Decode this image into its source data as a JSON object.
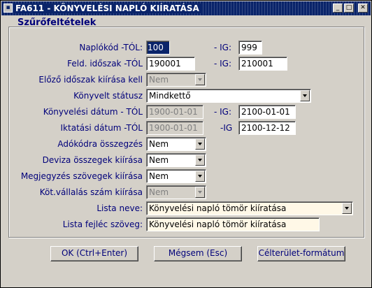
{
  "window": {
    "title": "FA611 - KÖNYVELÉSI NAPLÓ KIÍRATÁSA",
    "app_icon": "form-icon"
  },
  "group_title": "Szűrőfeltételek",
  "fields": {
    "naplokod": {
      "label": "Naplókód -TÓL:",
      "from": "100",
      "to_label": "- IG:",
      "to": "999"
    },
    "feld_idoszak": {
      "label": "Feld. időszak -TÓL",
      "from": "190001",
      "to_label": "- IG:",
      "to": "210001"
    },
    "elozo_idoszak": {
      "label": "Előző időszak kiírása kell",
      "value": "Nem"
    },
    "konyvelt_statusz": {
      "label": "Könyvelt státusz",
      "value": "Mindkettő"
    },
    "konyvelesi_datum": {
      "label": "Könyvelési dátum - TÓL",
      "from": "1900-01-01",
      "to_label": "- IG:",
      "to": "2100-01-01"
    },
    "iktatasi_datum": {
      "label": "Iktatási dátum -TÓL",
      "from": "1900-01-01",
      "to_label": "-IG",
      "to": "2100-12-12"
    },
    "adokodra": {
      "label": "Adókódra összegzés",
      "value": "Nem"
    },
    "deviza": {
      "label": "Deviza összegek kiírása",
      "value": "Nem"
    },
    "megjegyzes": {
      "label": "Megjegyzés szövegek kiírása",
      "value": "Nem"
    },
    "kotvallalas": {
      "label": "Köt.vállalás szám kiírása",
      "value": "Nem"
    },
    "lista_neve": {
      "label": "Lista neve:",
      "value": "Könyvelési napló tömör kiíratása"
    },
    "lista_fejlec": {
      "label": "Lista fejléc szöveg:",
      "value": "Könyvelési napló tömör kiíratása"
    }
  },
  "buttons": {
    "ok": "OK (Ctrl+Enter)",
    "cancel": "Mégsem (Esc)",
    "target": "Célterület-formátum"
  }
}
